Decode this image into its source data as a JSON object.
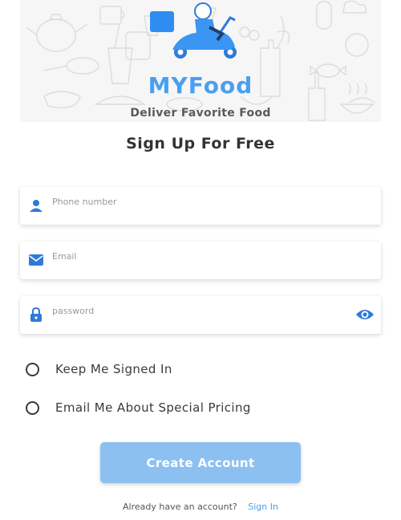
{
  "brand": {
    "title": "MYFood",
    "tagline": "Deliver Favorite Food"
  },
  "page_title": "Sign Up For Free",
  "fields": {
    "phone": {
      "placeholder": "Phone number",
      "icon": "person-icon"
    },
    "email": {
      "placeholder": "Email",
      "icon": "mail-icon"
    },
    "password": {
      "placeholder": "password",
      "icon": "lock-icon",
      "toggle_icon": "eye-icon"
    }
  },
  "options": {
    "keep_signed_in": "Keep Me Signed In",
    "email_pricing": "Email Me About Special Pricing"
  },
  "create_button_label": "Create Account",
  "footer": {
    "prompt": "Already have an account?",
    "signin_label": "Sign In"
  },
  "colors": {
    "brand_blue": "#4a9ff0",
    "button_bg": "#8cc0f1",
    "hero_bg": "#f6f6f6"
  }
}
